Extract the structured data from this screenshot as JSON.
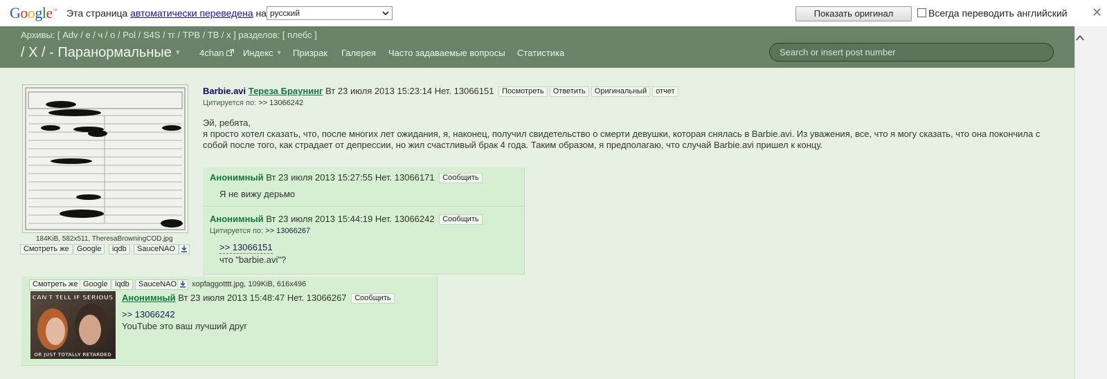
{
  "translate_bar": {
    "logo": "Google",
    "logo_tm": "™",
    "message_prefix": "Эта страница",
    "message_link": "автоматически переведена",
    "message_suffix": "на",
    "language": "русский",
    "show_original": "Показать оригинал",
    "always_translate": "Всегда переводить английский",
    "close": "✕"
  },
  "header": {
    "archives": "Архивы: [ Adv / е / ч / о / Pol / S4S / тг / TPB / TB / x ] разделов: [ плебс ]",
    "board_title": "/ X / - Паранормальные",
    "nav": [
      "4chan",
      "Индекс",
      "Призрак",
      "Галерея",
      "Часто задаваемые вопросы",
      "Статистика"
    ],
    "search_placeholder": "Search or insert post number"
  },
  "op": {
    "file_info": "184KiB, 582x511, TheresaBrowningCOD.jpg",
    "tools": [
      "Смотреть же",
      "Google",
      "iqdb",
      "SauceNAO"
    ],
    "subject": "Barbie.avi",
    "name": "Тереза Браунинг",
    "date": "Вт 23 июля 2013 15:23:14",
    "number": "Нет. 13066151",
    "buttons": [
      "Посмотреть",
      "Ответить",
      "Оригинальный",
      "отчет"
    ],
    "cited_label": "Цитируется по:",
    "cited": ">> 13066242",
    "body_line1": "Эй, ребята,",
    "body_line2": "я просто хотел сказать, что, после многих лет ожидания, я, наконец, получил свидетельство о смерти девушки, которая снялась в Barbie.avi. Из уважения, все, что я могу сказать, что она покончила с собой после того, как страдает от депрессии, но жил счастливый брак 4 года. Таким образом, я предполагаю, что случай Barbie.avi пришел к концу."
  },
  "replies": [
    {
      "name": "Анонимный",
      "date": "Вт 23 июля 2013 15:27:55",
      "number": "Нет. 13066171",
      "button": "Сообщить",
      "body": "Я не вижу дерьмо"
    },
    {
      "name": "Анонимный",
      "date": "Вт 23 июля 2013 15:44:19",
      "number": "Нет. 13066242",
      "button": "Сообщить",
      "cited_label": "Цитируется по:",
      "cited": ">> 13066267",
      "quote": ">> 13066151",
      "body": "что \"barbie.avi\"?"
    },
    {
      "tools": [
        "Смотреть же",
        "Google",
        "iqdb",
        "SauceNAO"
      ],
      "file_info": "xopfaggotttt.jpg, 109KiB, 616x496",
      "image_text_top": "CAN'T TELL IF SERIOUS",
      "image_text_bottom": "OR JUST TOTALLY RETARDED",
      "name": "Анонимный",
      "date": "Вт 23 июля 2013 15:48:47",
      "number": "Нет. 13066267",
      "button": "Сообщить",
      "quote": ">> 13066242",
      "body": "YouTube это ваш лучший друг"
    }
  ],
  "colors": {
    "page_bg": "#e6f1e3",
    "header_bg": "#6a8368",
    "reply_bg": "#d6eed2",
    "subject": "#0f0c5d",
    "name": "#117743"
  }
}
